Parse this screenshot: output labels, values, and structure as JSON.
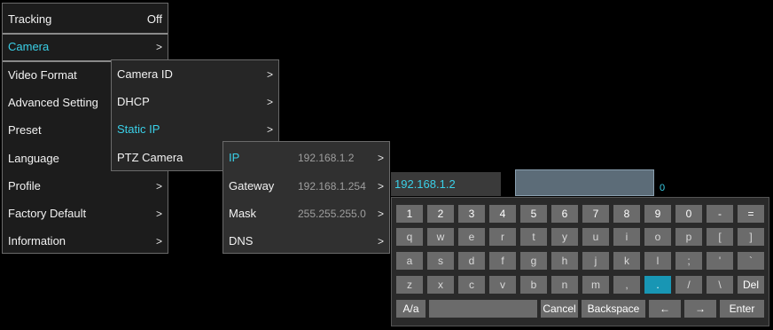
{
  "main_menu": {
    "items": [
      {
        "label": "Tracking",
        "value": "Off"
      },
      {
        "label": "Camera",
        "chevron": ">"
      },
      {
        "label": "Video Format"
      },
      {
        "label": "Advanced Setting"
      },
      {
        "label": "Preset"
      },
      {
        "label": "Language"
      },
      {
        "label": "Profile",
        "chevron": ">"
      },
      {
        "label": "Factory Default",
        "chevron": ">"
      },
      {
        "label": "Information",
        "chevron": ">"
      }
    ]
  },
  "camera_menu": {
    "items": [
      {
        "label": "Camera ID",
        "chevron": ">"
      },
      {
        "label": "DHCP",
        "chevron": ">"
      },
      {
        "label": "Static IP",
        "chevron": ">"
      },
      {
        "label": "PTZ Camera"
      }
    ]
  },
  "static_ip_menu": {
    "items": [
      {
        "label": "IP",
        "value": "192.168.1.2",
        "chevron": ">"
      },
      {
        "label": "Gateway",
        "value": "192.168.1.254",
        "chevron": ">"
      },
      {
        "label": "Mask",
        "value": "255.255.255.0",
        "chevron": ">"
      },
      {
        "label": "DNS",
        "value": "",
        "chevron": ">"
      }
    ]
  },
  "ip_input": {
    "value": "192.168.1.2",
    "cursor_counter": "0"
  },
  "keyboard": {
    "row1": [
      "1",
      "2",
      "3",
      "4",
      "5",
      "6",
      "7",
      "8",
      "9",
      "0",
      "-",
      "="
    ],
    "row2": [
      "q",
      "w",
      "e",
      "r",
      "t",
      "y",
      "u",
      "i",
      "o",
      "p",
      "[",
      "]"
    ],
    "row3": [
      "a",
      "s",
      "d",
      "f",
      "g",
      "h",
      "j",
      "k",
      "l",
      ";",
      "'",
      "`"
    ],
    "row4": [
      "z",
      "x",
      "c",
      "v",
      "b",
      "n",
      "m",
      ",",
      ".",
      "/",
      "\\",
      "Del"
    ],
    "row5": {
      "case": "A/a",
      "cancel": "Cancel",
      "backspace": "Backspace",
      "left": "←",
      "right": "→",
      "enter": "Enter"
    },
    "selected_key": "."
  },
  "colors": {
    "accent": "#3ad0e8",
    "selected_key": "#1896b4"
  }
}
